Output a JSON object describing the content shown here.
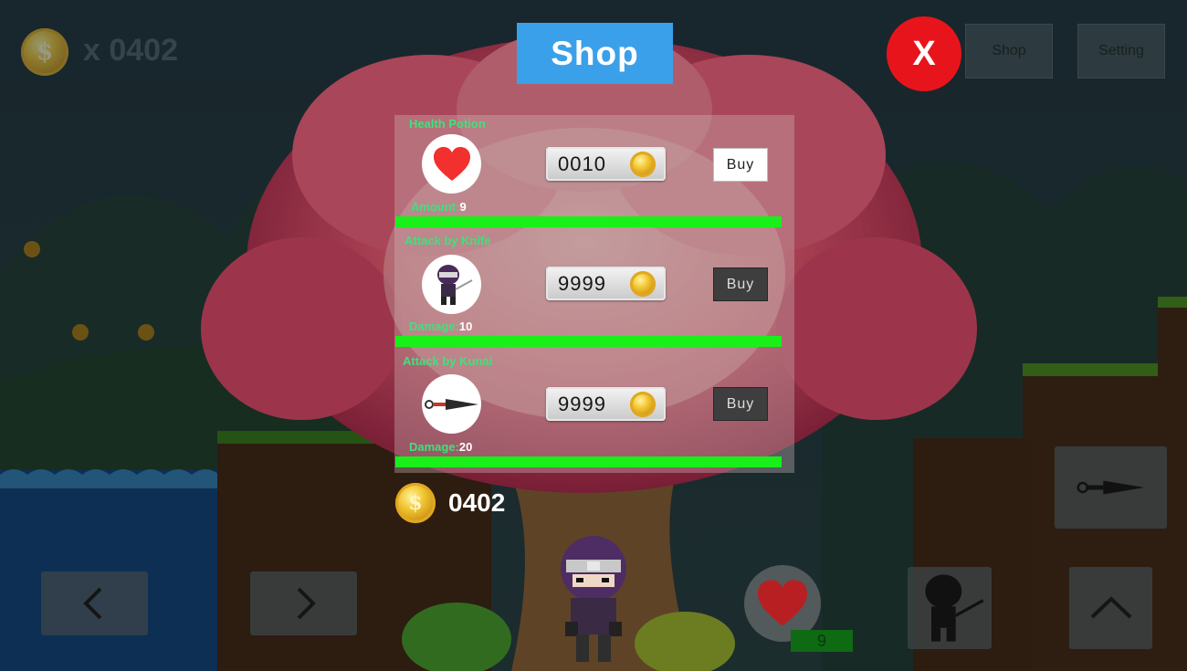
{
  "hud": {
    "coin_count": "x 0402",
    "shop_button": "Shop",
    "setting_button": "Setting",
    "close_label": "X",
    "health_count": "9"
  },
  "shop": {
    "title": "Shop",
    "items": [
      {
        "name": "Health Potion",
        "stat_label": "Amount:",
        "stat_value": "9",
        "price": "0010",
        "buy_label": "Buy",
        "icon": "heart-icon"
      },
      {
        "name": "Attack by Knife",
        "stat_label": "Damage:",
        "stat_value": "10",
        "price": "9999",
        "buy_label": "Buy",
        "icon": "ninja-knife-icon"
      },
      {
        "name": "Attack by Kunai",
        "stat_label": "Damage:",
        "stat_value": "20",
        "price": "9999",
        "buy_label": "Buy",
        "icon": "kunai-icon"
      }
    ],
    "balance": "0402"
  },
  "coin_symbol": "$",
  "colors": {
    "accent": "#3aa0ea",
    "close": "#e8141b",
    "stat_text": "#3ee27b",
    "separator": "#19ef19"
  }
}
